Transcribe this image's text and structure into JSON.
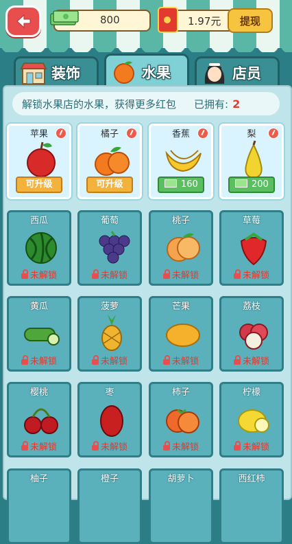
{
  "header": {
    "coins": "800",
    "red_packet_balance": "1.97元",
    "withdraw_label": "提现"
  },
  "tabs": [
    {
      "label": "装饰",
      "active": false
    },
    {
      "label": "水果",
      "active": true
    },
    {
      "label": "店员",
      "active": false
    }
  ],
  "banner": {
    "text": "解锁水果店的水果，获得更多红包",
    "owned_label": "已拥有:",
    "owned_count": "2"
  },
  "fruits": [
    {
      "name": "苹果",
      "status": "upgrade",
      "action": "可升级",
      "icon": "apple-icon"
    },
    {
      "name": "橘子",
      "status": "upgrade",
      "action": "可升级",
      "icon": "orange-icon"
    },
    {
      "name": "香蕉",
      "status": "price",
      "action": "160",
      "icon": "banana-icon"
    },
    {
      "name": "梨",
      "status": "price",
      "action": "200",
      "icon": "pear-icon"
    },
    {
      "name": "西瓜",
      "status": "locked",
      "action": "未解锁",
      "icon": "watermelon-icon"
    },
    {
      "name": "葡萄",
      "status": "locked",
      "action": "未解锁",
      "icon": "grape-icon"
    },
    {
      "name": "桃子",
      "status": "locked",
      "action": "未解锁",
      "icon": "peach-icon"
    },
    {
      "name": "草莓",
      "status": "locked",
      "action": "未解锁",
      "icon": "strawberry-icon"
    },
    {
      "name": "黄瓜",
      "status": "locked",
      "action": "未解锁",
      "icon": "cucumber-icon"
    },
    {
      "name": "菠萝",
      "status": "locked",
      "action": "未解锁",
      "icon": "pineapple-icon"
    },
    {
      "name": "芒果",
      "status": "locked",
      "action": "未解锁",
      "icon": "mango-icon"
    },
    {
      "name": "荔枝",
      "status": "locked",
      "action": "未解锁",
      "icon": "lychee-icon"
    },
    {
      "name": "樱桃",
      "status": "locked",
      "action": "未解锁",
      "icon": "cherry-icon"
    },
    {
      "name": "枣",
      "status": "locked",
      "action": "未解锁",
      "icon": "jujube-icon"
    },
    {
      "name": "柿子",
      "status": "locked",
      "action": "未解锁",
      "icon": "persimmon-icon"
    },
    {
      "name": "柠檬",
      "status": "locked",
      "action": "未解锁",
      "icon": "lemon-icon"
    },
    {
      "name": "柚子",
      "status": "locked",
      "action": "",
      "icon": "pomelo-icon"
    },
    {
      "name": "橙子",
      "status": "locked",
      "action": "",
      "icon": "orange2-icon"
    },
    {
      "name": "胡萝卜",
      "status": "locked",
      "action": "",
      "icon": "carrot-icon"
    },
    {
      "name": "西红柿",
      "status": "locked",
      "action": "",
      "icon": "tomato-icon"
    }
  ],
  "colors": {
    "awning_green": "#5ab7a5",
    "tab_bg": "#3a8f95",
    "locked_card": "#5ab0bb",
    "unlocked_card": "#d9f4ff",
    "lock_red": "#e23a2f",
    "upgrade_orange": "#f3b23b",
    "price_green": "#5bbf62"
  }
}
